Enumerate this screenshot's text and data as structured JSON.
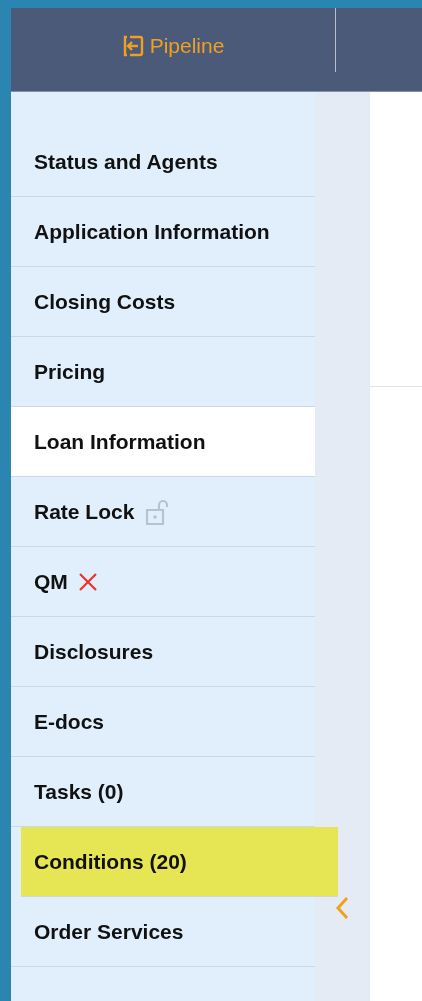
{
  "header": {
    "pipeline_link": "Pipeline"
  },
  "sidebar": {
    "items": [
      {
        "label": "Status and Agents",
        "selected": false,
        "highlighted": false
      },
      {
        "label": "Application Information",
        "selected": false,
        "highlighted": false
      },
      {
        "label": "Closing Costs",
        "selected": false,
        "highlighted": false
      },
      {
        "label": "Pricing",
        "selected": false,
        "highlighted": false
      },
      {
        "label": "Loan Information",
        "selected": true,
        "highlighted": false
      },
      {
        "label": "Rate Lock",
        "selected": false,
        "highlighted": false,
        "kind": "lock"
      },
      {
        "label": "QM",
        "selected": false,
        "highlighted": false,
        "kind": "cross"
      },
      {
        "label": "Disclosures",
        "selected": false,
        "highlighted": false
      },
      {
        "label": "E-docs",
        "selected": false,
        "highlighted": false
      },
      {
        "label": "Tasks (0)",
        "selected": false,
        "highlighted": false
      },
      {
        "label": "Conditions (20)",
        "selected": false,
        "highlighted": true
      },
      {
        "label": "Order Services",
        "selected": false,
        "highlighted": false
      }
    ]
  }
}
